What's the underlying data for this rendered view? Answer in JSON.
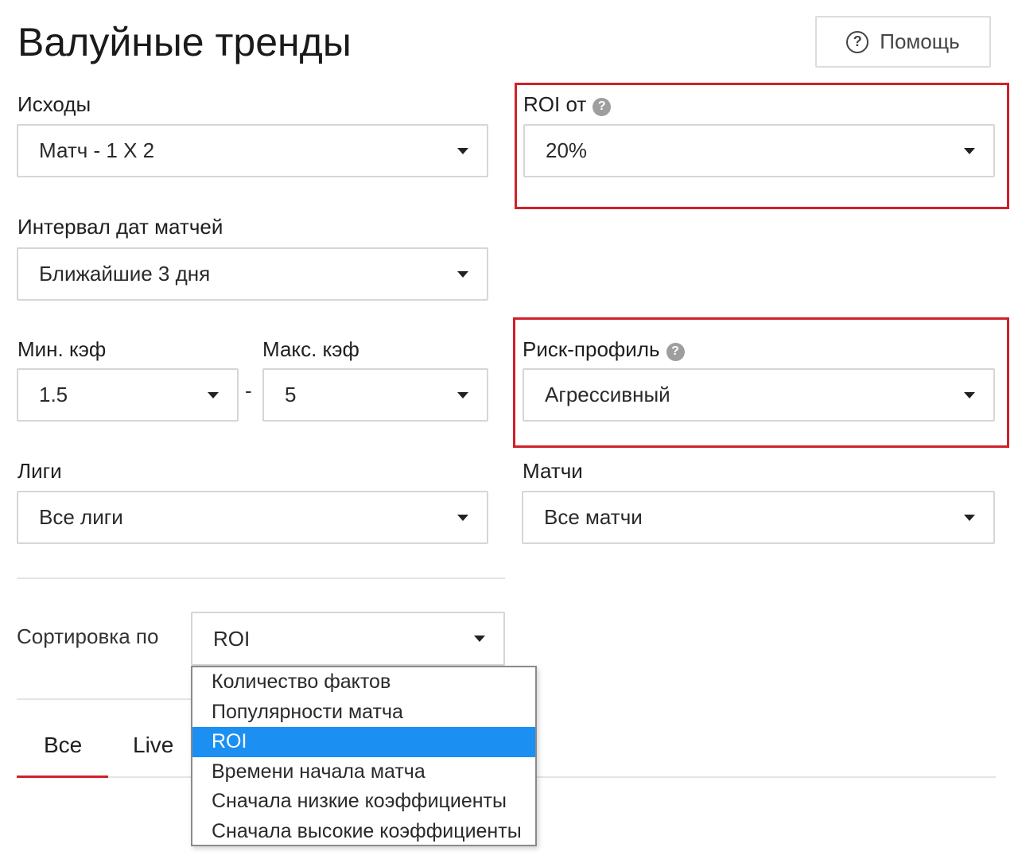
{
  "page": {
    "title": "Валуйные тренды"
  },
  "help": {
    "label": "Помощь",
    "icon": "?"
  },
  "filters": {
    "outcomes": {
      "label": "Исходы",
      "value": "Матч - 1 X 2"
    },
    "roi_from": {
      "label": "ROI от",
      "value": "20%"
    },
    "date_range": {
      "label": "Интервал дат матчей",
      "value": "Ближайшие 3 дня"
    },
    "min_odds": {
      "label": "Мин. кэф",
      "value": "1.5"
    },
    "max_odds": {
      "label": "Макс. кэф",
      "value": "5"
    },
    "range_separator": "-",
    "risk_profile": {
      "label": "Риск-профиль",
      "value": "Агрессивный"
    },
    "leagues": {
      "label": "Лиги",
      "value": "Все лиги"
    },
    "matches": {
      "label": "Матчи",
      "value": "Все матчи"
    }
  },
  "sort": {
    "label": "Сортировка по",
    "value": "ROI",
    "options": [
      "Количество фактов",
      "Популярности матча",
      "ROI",
      "Времени начала матча",
      "Сначала низкие коэффициенты",
      "Сначала высокие коэффициенты"
    ],
    "selected_option": "ROI"
  },
  "tabs": {
    "all": "Все",
    "live": "Live",
    "active": "Все"
  },
  "colors": {
    "highlight": "#d0202a",
    "selected_option": "#1b8ff2",
    "tab_underline": "#d0202a"
  }
}
